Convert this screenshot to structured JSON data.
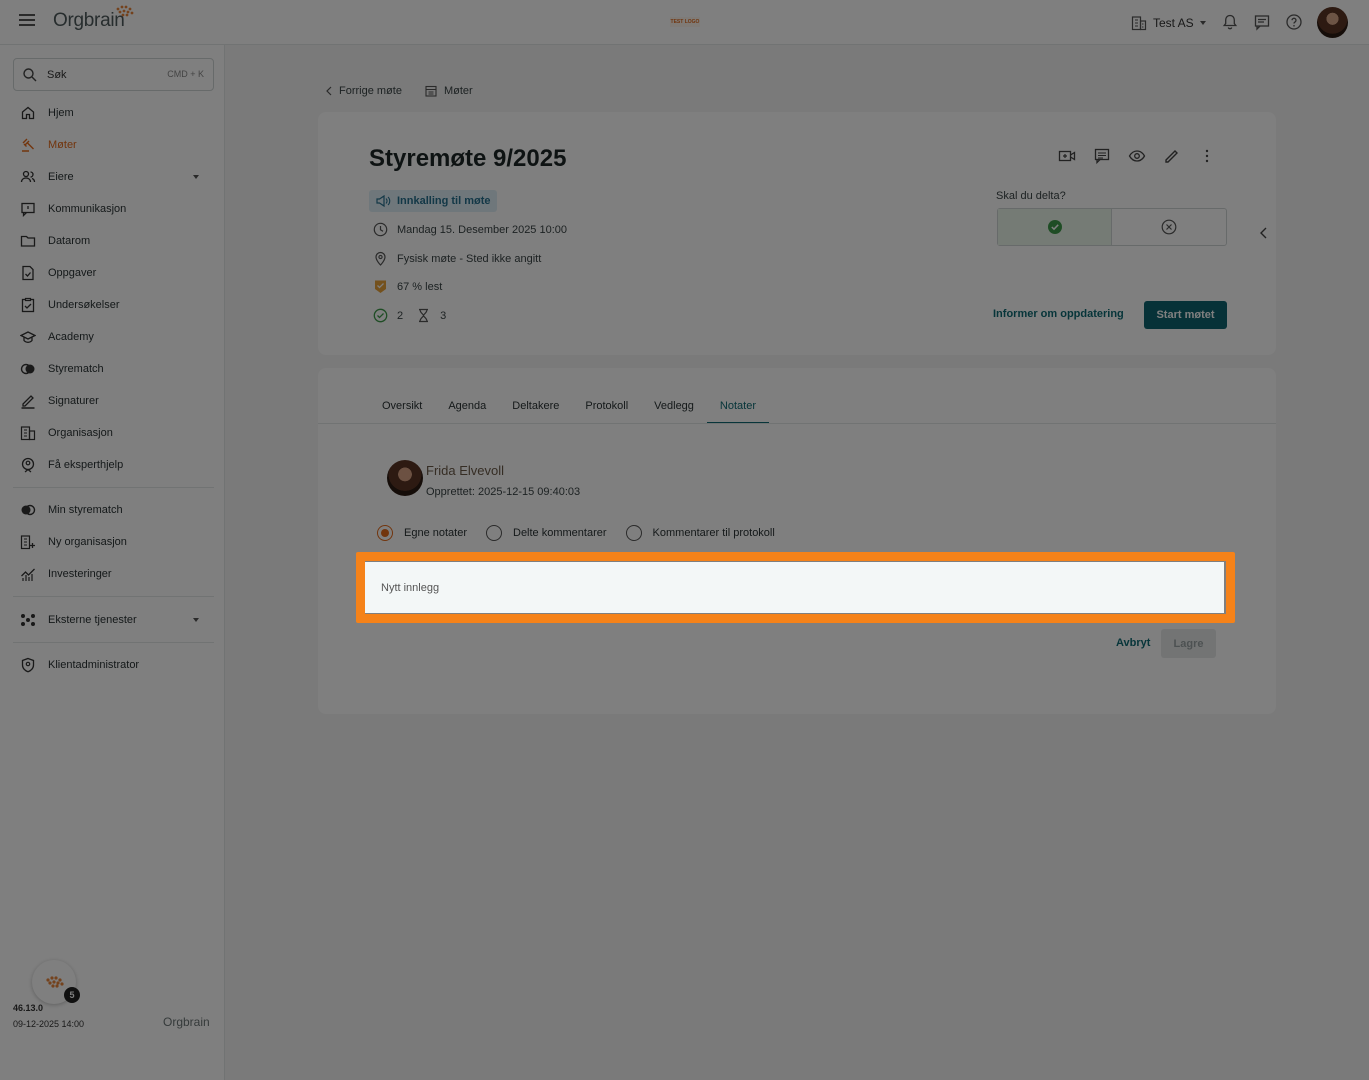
{
  "topbar": {
    "logo": "Orgbrain",
    "test_logo": "TEST LOGO",
    "org_name": "Test AS"
  },
  "sidebar": {
    "search_label": "Søk",
    "search_shortcut": "CMD + K",
    "items": [
      {
        "label": "Hjem"
      },
      {
        "label": "Møter"
      },
      {
        "label": "Eiere"
      },
      {
        "label": "Kommunikasjon"
      },
      {
        "label": "Datarom"
      },
      {
        "label": "Oppgaver"
      },
      {
        "label": "Undersøkelser"
      },
      {
        "label": "Academy"
      },
      {
        "label": "Styrematch"
      },
      {
        "label": "Signaturer"
      },
      {
        "label": "Organisasjon"
      },
      {
        "label": "Få eksperthjelp"
      }
    ],
    "secondary": [
      {
        "label": "Min styrematch"
      },
      {
        "label": "Ny organisasjon"
      },
      {
        "label": "Investeringer"
      }
    ],
    "external": "Eksterne tjenester",
    "admin": "Klientadministrator",
    "version": "46.13.0",
    "build_date": "09-12-2025 14:00",
    "bottom_logo": "Orgbrain",
    "fab_badge": "5"
  },
  "breadcrumb": {
    "prev": "Forrige møte",
    "meetings": "Møter"
  },
  "meeting": {
    "title": "Styremøte 9/2025",
    "invitation": "Innkalling til møte",
    "datetime": "Mandag 15. Desember 2025 10:00",
    "location": "Fysisk møte - Sted ikke angitt",
    "read": "67 % lest",
    "accepted_count": "2",
    "pending_count": "3",
    "attend_question": "Skal du delta?",
    "inform_link": "Informer om oppdatering",
    "start_button": "Start møtet"
  },
  "tabs": [
    {
      "label": "Oversikt"
    },
    {
      "label": "Agenda"
    },
    {
      "label": "Deltakere"
    },
    {
      "label": "Protokoll"
    },
    {
      "label": "Vedlegg"
    },
    {
      "label": "Notater"
    }
  ],
  "notes": {
    "author": "Frida Elvevoll",
    "created": "Opprettet: 2025-12-15 09:40:03",
    "options": [
      {
        "label": "Egne notater"
      },
      {
        "label": "Delte kommentarer"
      },
      {
        "label": "Kommentarer til protokoll"
      }
    ],
    "input_placeholder": "Nytt innlegg",
    "input_value": "",
    "cancel": "Avbryt",
    "save": "Lagre"
  },
  "colors": {
    "accent": "#e46a1b",
    "primary": "#0e6470",
    "highlight": "#f58219"
  }
}
